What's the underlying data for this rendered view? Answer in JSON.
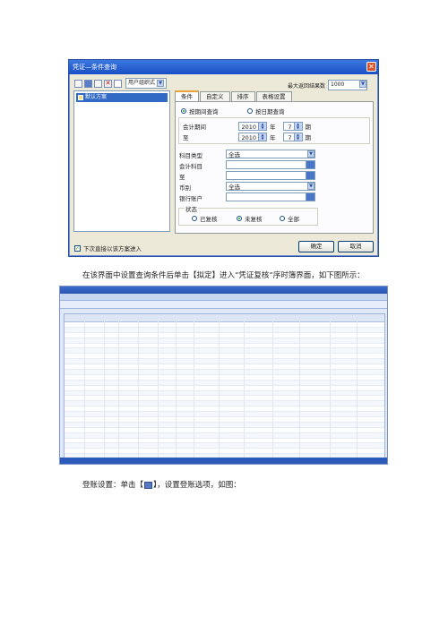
{
  "dialog": {
    "title": "凭证—条件查询",
    "toolbar": {
      "user_combo": "用户组织式"
    },
    "max_results_label": "最大返回结果数",
    "max_results_value": "1000",
    "schemes": [
      "默认方案"
    ],
    "tabs": [
      "条件",
      "自定义",
      "排序",
      "表格设置"
    ],
    "query_mode": {
      "by_period": "按期间查询",
      "by_date": "按日期查询"
    },
    "period_from": {
      "label": "会计期间",
      "year": "2010",
      "year_unit": "年",
      "period": "7",
      "period_unit": "期"
    },
    "period_to": {
      "label": "至",
      "year": "2010",
      "year_unit": "年",
      "period": "7",
      "period_unit": "期"
    },
    "fields": [
      {
        "label": "科目类型",
        "value": "全选"
      },
      {
        "label": "会计科目",
        "value": ""
      },
      {
        "label": "至",
        "value": ""
      },
      {
        "label": "币别",
        "value": "全选"
      },
      {
        "label": "银行账户",
        "value": ""
      }
    ],
    "status": {
      "label": "状态",
      "options": [
        "已复核",
        "未复核",
        "全部"
      ],
      "selected": 1
    },
    "bottom_check": "下次直接以该方案进入",
    "ok_label": "确定",
    "cancel_label": "取消",
    "check_mark": "✓",
    "close_glyph": "✕",
    "arrow_glyph": "▼",
    "up_glyph": "▲"
  },
  "text": {
    "para1": "在该界面中设置查询条件后单击【拟定】进入“凭证复核”序时簿界面，如下图所示：",
    "para2_before": "登账设置：单击【",
    "para2_after": "】，设置登账选项，如图："
  }
}
